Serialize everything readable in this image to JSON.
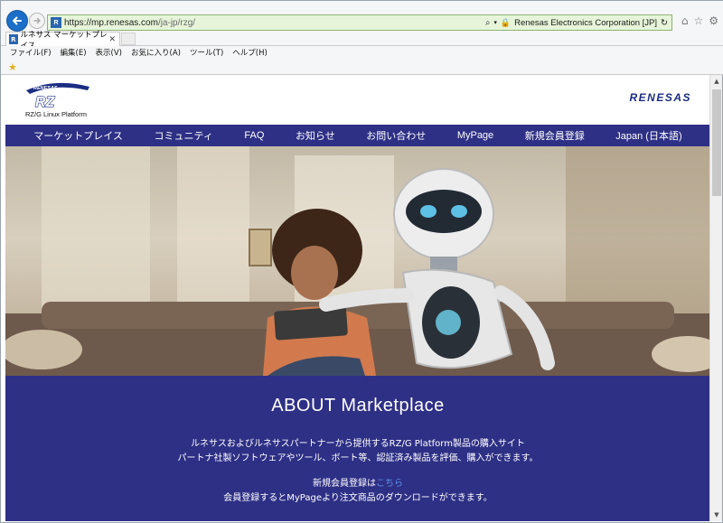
{
  "browser": {
    "url_proto": "https://",
    "url_host": "mp.renesas.com",
    "url_path": "/ja-jp/rzg/",
    "site_identity": "Renesas Electronics Corporation [JP]",
    "tab_title": "ルネサス マーケットプレイス",
    "menu": [
      "ファイル(F)",
      "編集(E)",
      "表示(V)",
      "お気に入り(A)",
      "ツール(T)",
      "ヘルプ(H)"
    ]
  },
  "site": {
    "logo_brand": "RENESAS",
    "logo_product": "RZ",
    "logo_subtitle": "RZ/G Linux Platform",
    "corp_logo": "RENESAS",
    "nav": [
      "マーケットプレイス",
      "コミュニティ",
      "FAQ",
      "お知らせ",
      "お問い合わせ",
      "MyPage",
      "新規会員登録",
      "Japan (日本語)"
    ]
  },
  "about": {
    "title": "ABOUT Marketplace",
    "line1": "ルネサスおよびルネサスパートナーから提供するRZ/G Platform製品の購入サイト",
    "line2": "パートナ社製ソフトウェアやツール、ボート等、認証済み製品を評価、購入ができます。",
    "line3_prefix": "新規会員登録は",
    "line3_link": "こちら",
    "line4": "会員登録するとMyPageより注文商品のダウンロードができます。"
  },
  "colors": {
    "brand_navy": "#2e3086",
    "link_blue": "#5d92e6",
    "ie_blue": "#1c6fc9"
  }
}
